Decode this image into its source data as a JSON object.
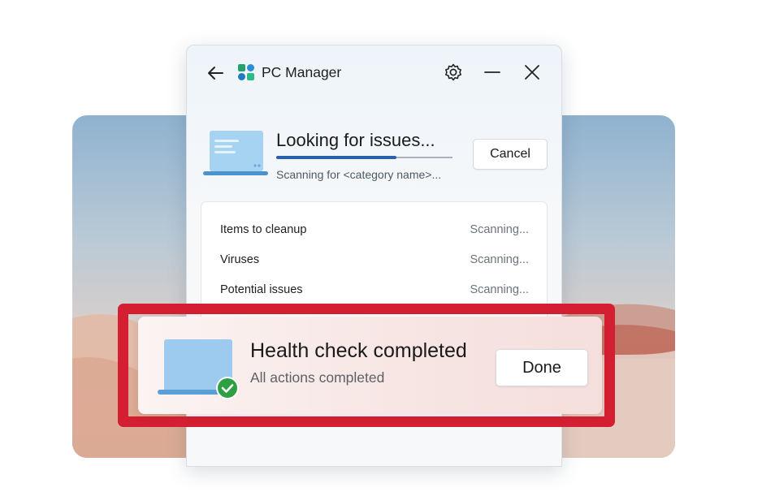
{
  "window": {
    "app_title": "PC Manager",
    "back_icon": "arrow-left-icon",
    "logo_icon": "pc-manager-logo-icon",
    "settings_icon": "gear-icon",
    "minimize_icon": "minimize-icon",
    "close_icon": "close-icon"
  },
  "scan": {
    "title": "Looking for issues...",
    "subtitle": "Scanning for <category name>...",
    "progress": 0.68,
    "cancel_label": "Cancel",
    "icon": "laptop-icon"
  },
  "results": [
    {
      "label": "Items to cleanup",
      "status": "Scanning..."
    },
    {
      "label": "Viruses",
      "status": "Scanning..."
    },
    {
      "label": "Potential issues",
      "status": "Scanning..."
    }
  ],
  "toast": {
    "title": "Health check completed",
    "subtitle": "All actions completed",
    "done_label": "Done",
    "icon": "laptop-checkmark-icon"
  },
  "colors": {
    "accent": "#2b61a8",
    "highlight": "#d41f32",
    "check": "#2ea043"
  }
}
